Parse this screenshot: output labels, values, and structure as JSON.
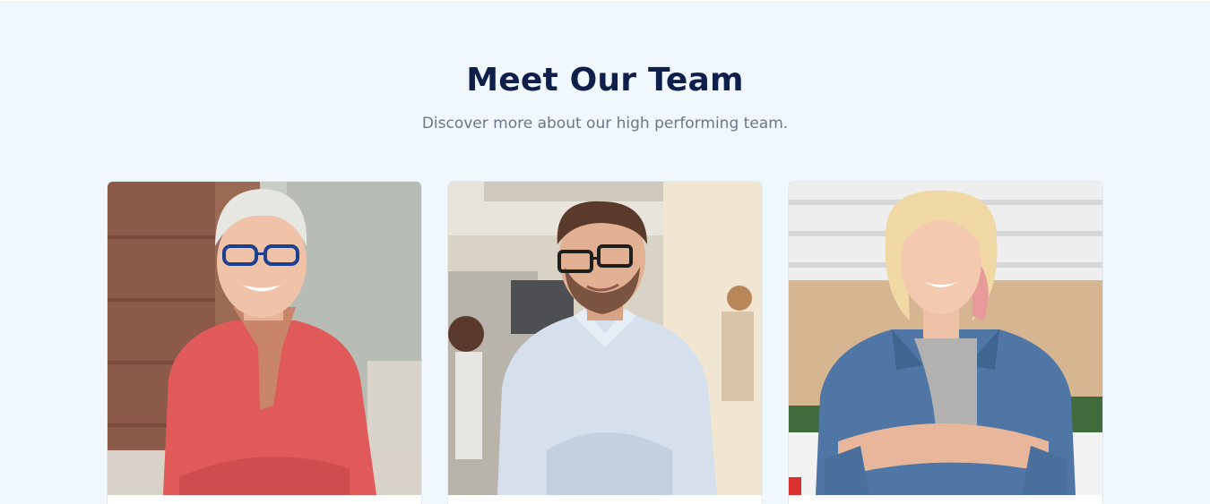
{
  "header": {
    "title": "Meet Our Team",
    "subtitle": "Discover more about our high performing team."
  },
  "team": [
    {
      "photo": "older-woman-portrait"
    },
    {
      "photo": "bearded-man-glasses-portrait"
    },
    {
      "photo": "blonde-woman-denim-portrait"
    }
  ]
}
